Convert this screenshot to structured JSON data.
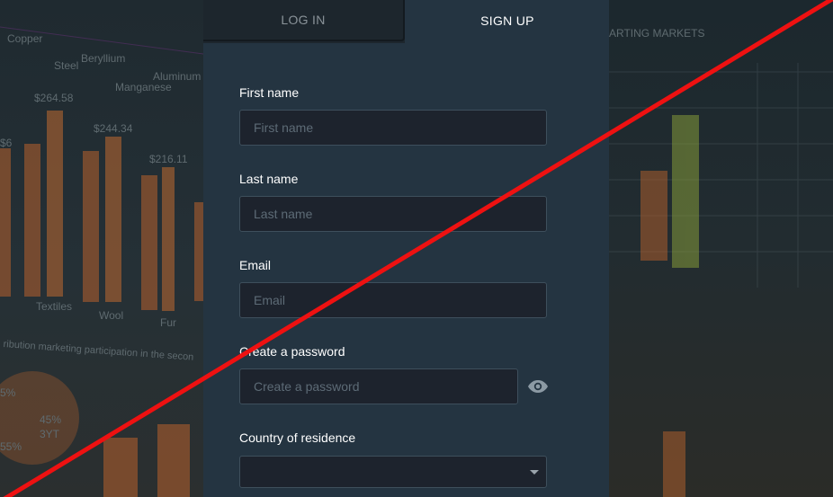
{
  "tabs": {
    "login": "LOG IN",
    "signup": "SIGN UP"
  },
  "form": {
    "first_name": {
      "label": "First name",
      "placeholder": "First name",
      "value": ""
    },
    "last_name": {
      "label": "Last name",
      "placeholder": "Last name",
      "value": ""
    },
    "email": {
      "label": "Email",
      "placeholder": "Email",
      "value": ""
    },
    "password": {
      "label": "Create a password",
      "placeholder": "Create a password",
      "value": ""
    },
    "country": {
      "label": "Country of residence",
      "value": ""
    }
  },
  "background": {
    "left_labels": [
      "Copper",
      "Steel",
      "Beryllium",
      "Aluminum",
      "Manganese",
      "$264.58",
      "$244.34",
      "$216.11",
      "Textiles",
      "Wool",
      "Fur",
      "$6",
      "45%",
      "3YT",
      "55%",
      "5%"
    ],
    "left_caption": "ribution marketing participation in the secon",
    "right_labels": [
      "ARTING MARKETS"
    ]
  },
  "icons": {
    "eye": "eye-icon",
    "caret": "caret-down-icon"
  },
  "colors": {
    "panel": "#243441",
    "input_bg": "#1d232d",
    "bar_orange": "#b8612c",
    "strike_line": "#ee1111"
  }
}
